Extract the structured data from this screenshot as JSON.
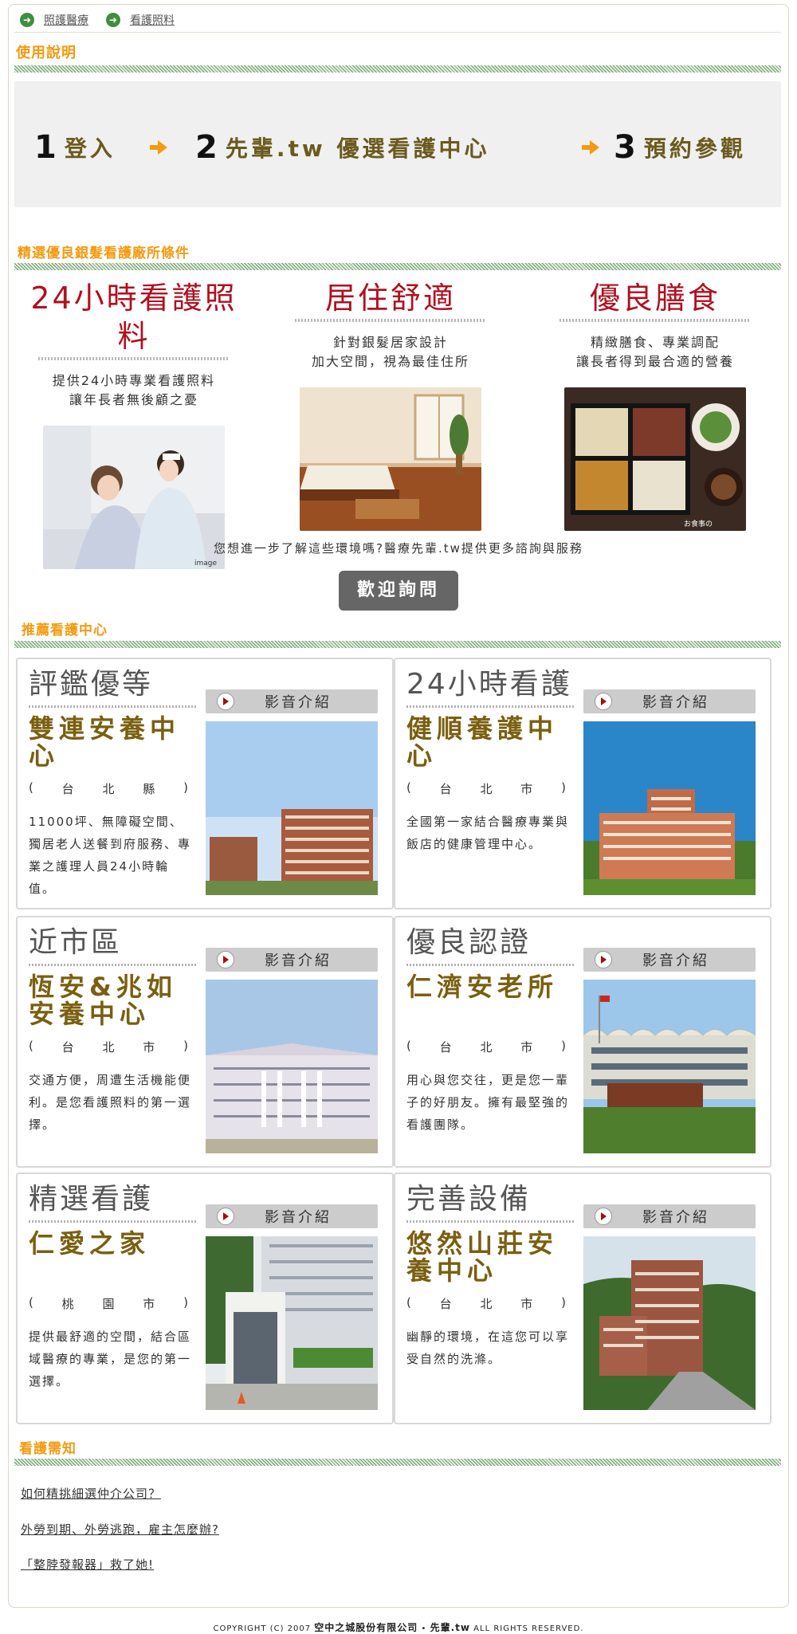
{
  "breadcrumb": [
    "照護醫療",
    "看護照料"
  ],
  "sections": {
    "usage": "使用說明",
    "criteria": "精選優良銀髮看護廠所條件",
    "recommended": "推薦看護中心",
    "notice": "看護需知"
  },
  "steps": [
    {
      "num": "1",
      "label": "登入"
    },
    {
      "num": "2",
      "label": "先輩.tw 優選看護中心"
    },
    {
      "num": "3",
      "label": "預約參觀"
    }
  ],
  "features": [
    {
      "title": "24小時看護照料",
      "desc_line1": "提供24小時專業看護照料",
      "desc_line2": "讓年長者無後顧之憂",
      "photo_caption": "image"
    },
    {
      "title": "居住舒適",
      "desc_line1": "針對銀髮居家設計",
      "desc_line2": "加大空間，視為最佳住所"
    },
    {
      "title": "優良膳食",
      "desc_line1": "精緻膳食、專業調配",
      "desc_line2": "讓長者得到最合適的營養",
      "photo_caption": "お食事の"
    }
  ],
  "info_text": "您想進一步了解這些環境嗎?醫療先輩.tw提供更多諮詢與服務",
  "inquiry_button": "歡迎詢問",
  "video_label": "影音介紹",
  "centers": [
    {
      "category": "評鑑優等",
      "name": "雙連安養中心",
      "region": [
        "(",
        "台",
        "北",
        "縣",
        ")"
      ],
      "desc": "11000坪、無障礙空間、獨居老人送餐到府服務、專業之護理人員24小時輪值。"
    },
    {
      "category": "24小時看護",
      "name": "健順養護中心",
      "region": [
        "(",
        "台",
        "北",
        "市",
        ")"
      ],
      "desc": "全國第一家結合醫療專業與飯店的健康管理中心。"
    },
    {
      "category": "近市區",
      "name": "恆安&兆如安養中心",
      "region": [
        "(",
        "台",
        "北",
        "市",
        ")"
      ],
      "desc": "交通方便，周遭生活機能便利。是您看護照料的第一選擇。"
    },
    {
      "category": "優良認證",
      "name": "仁濟安老所",
      "region": [
        "(",
        "台",
        "北",
        "市",
        ")"
      ],
      "desc": "用心與您交往，更是您一輩子的好朋友。擁有最堅強的看護團隊。"
    },
    {
      "category": "精選看護",
      "name": "仁愛之家",
      "region": [
        "(",
        "桃",
        "園",
        "市",
        ")"
      ],
      "desc": "提供最舒適的空間，結合區域醫療的專業，是您的第一選擇。"
    },
    {
      "category": "完善設備",
      "name": "悠然山莊安養中心",
      "region": [
        "(",
        "台",
        "北",
        "市",
        ")"
      ],
      "desc": "幽靜的環境，在這您可以享受自然的洗滌。"
    }
  ],
  "notice_links": [
    "如何精挑細選仲介公司？",
    "外勞到期、外勞逃跑，雇主怎麼辦?",
    "「整脖發報器」救了她!"
  ],
  "footer": {
    "pre": "COPYRIGHT (C) 2007",
    "company": "空中之城股份有限公司",
    "brand": "先輩.tw",
    "post": "ALL RIGHTS RESERVED."
  },
  "colors": {
    "accent_orange": "#f39a10",
    "title_red": "#b01020",
    "name_gold": "#7a5f10",
    "hatch_green": "#6a9a66"
  }
}
